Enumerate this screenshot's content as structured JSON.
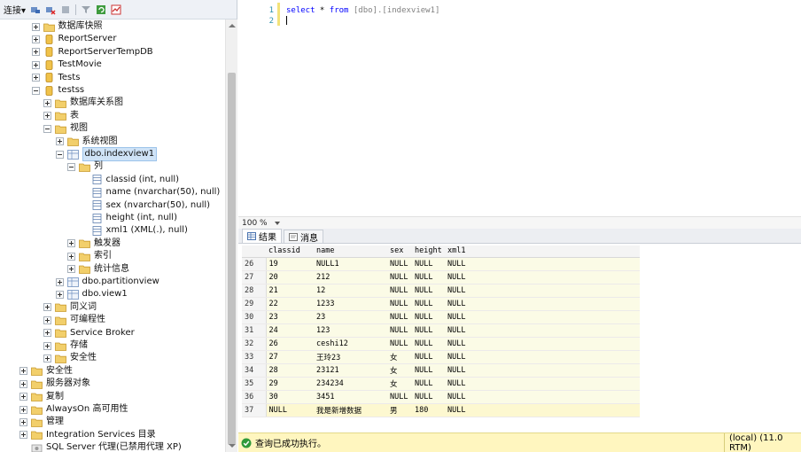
{
  "explorer": {
    "toolbar_label": "连接",
    "toolbar_dropdown": "▾",
    "tree": [
      {
        "label": "数据库快照",
        "depth": 1,
        "exp": "plus",
        "icon": "folder-icon"
      },
      {
        "label": "ReportServer",
        "depth": 1,
        "exp": "plus",
        "icon": "database-icon"
      },
      {
        "label": "ReportServerTempDB",
        "depth": 1,
        "exp": "plus",
        "icon": "database-icon"
      },
      {
        "label": "TestMovie",
        "depth": 1,
        "exp": "plus",
        "icon": "database-icon"
      },
      {
        "label": "Tests",
        "depth": 1,
        "exp": "plus",
        "icon": "database-icon"
      },
      {
        "label": "testss",
        "depth": 1,
        "exp": "minus",
        "icon": "database-icon"
      },
      {
        "label": "数据库关系图",
        "depth": 2,
        "exp": "plus",
        "icon": "folder-icon"
      },
      {
        "label": "表",
        "depth": 2,
        "exp": "plus",
        "icon": "folder-icon"
      },
      {
        "label": "视图",
        "depth": 2,
        "exp": "minus",
        "icon": "folder-icon"
      },
      {
        "label": "系统视图",
        "depth": 3,
        "exp": "plus",
        "icon": "folder-icon"
      },
      {
        "label": "dbo.indexview1",
        "depth": 3,
        "exp": "minus",
        "icon": "view-icon",
        "selected": true
      },
      {
        "label": "列",
        "depth": 4,
        "exp": "minus",
        "icon": "folder-icon"
      },
      {
        "label": "classid (int, null)",
        "depth": 5,
        "exp": "none",
        "icon": "column-icon"
      },
      {
        "label": "name (nvarchar(50), null)",
        "depth": 5,
        "exp": "none",
        "icon": "column-icon"
      },
      {
        "label": "sex (nvarchar(50), null)",
        "depth": 5,
        "exp": "none",
        "icon": "column-icon"
      },
      {
        "label": "height (int, null)",
        "depth": 5,
        "exp": "none",
        "icon": "column-icon"
      },
      {
        "label": "xml1 (XML(.), null)",
        "depth": 5,
        "exp": "none",
        "icon": "column-icon"
      },
      {
        "label": "触发器",
        "depth": 4,
        "exp": "plus",
        "icon": "folder-icon"
      },
      {
        "label": "索引",
        "depth": 4,
        "exp": "plus",
        "icon": "folder-icon"
      },
      {
        "label": "统计信息",
        "depth": 4,
        "exp": "plus",
        "icon": "folder-icon"
      },
      {
        "label": "dbo.partitionview",
        "depth": 3,
        "exp": "plus",
        "icon": "view-icon"
      },
      {
        "label": "dbo.view1",
        "depth": 3,
        "exp": "plus",
        "icon": "view-icon"
      },
      {
        "label": "同义词",
        "depth": 2,
        "exp": "plus",
        "icon": "folder-icon"
      },
      {
        "label": "可编程性",
        "depth": 2,
        "exp": "plus",
        "icon": "folder-icon"
      },
      {
        "label": "Service Broker",
        "depth": 2,
        "exp": "plus",
        "icon": "folder-icon"
      },
      {
        "label": "存储",
        "depth": 2,
        "exp": "plus",
        "icon": "folder-icon"
      },
      {
        "label": "安全性",
        "depth": 2,
        "exp": "plus",
        "icon": "folder-icon"
      },
      {
        "label": "安全性",
        "depth": 0,
        "exp": "plus",
        "icon": "folder-icon"
      },
      {
        "label": "服务器对象",
        "depth": 0,
        "exp": "plus",
        "icon": "folder-icon"
      },
      {
        "label": "复制",
        "depth": 0,
        "exp": "plus",
        "icon": "folder-icon"
      },
      {
        "label": "AlwaysOn 高可用性",
        "depth": 0,
        "exp": "plus",
        "icon": "folder-icon"
      },
      {
        "label": "管理",
        "depth": 0,
        "exp": "plus",
        "icon": "folder-icon"
      },
      {
        "label": "Integration Services 目录",
        "depth": 0,
        "exp": "plus",
        "icon": "folder-icon"
      },
      {
        "label": "SQL Server 代理(已禁用代理 XP)",
        "depth": 0,
        "exp": "none",
        "icon": "agent-icon"
      }
    ]
  },
  "editor": {
    "lines": [
      {
        "num": "1",
        "kw": "select",
        "mid": " * ",
        "kw2": "from",
        "rest": " [dbo].[indexview1]"
      },
      {
        "num": "2",
        "kw": "",
        "mid": "",
        "kw2": "",
        "rest": ""
      }
    ]
  },
  "zoom": {
    "value": "100 %"
  },
  "tabs": {
    "results": "结果",
    "messages": "消息"
  },
  "results": {
    "columns": [
      "classid",
      "name",
      "sex",
      "height",
      "xml1"
    ],
    "rows": [
      {
        "n": "26",
        "cells": [
          "19",
          "NULL1",
          "NULL",
          "NULL",
          "NULL"
        ]
      },
      {
        "n": "27",
        "cells": [
          "20",
          "212",
          "NULL",
          "NULL",
          "NULL"
        ]
      },
      {
        "n": "28",
        "cells": [
          "21",
          "12",
          "NULL",
          "NULL",
          "NULL"
        ]
      },
      {
        "n": "29",
        "cells": [
          "22",
          "1233",
          "NULL",
          "NULL",
          "NULL"
        ]
      },
      {
        "n": "30",
        "cells": [
          "23",
          "23",
          "NULL",
          "NULL",
          "NULL"
        ]
      },
      {
        "n": "31",
        "cells": [
          "24",
          "123",
          "NULL",
          "NULL",
          "NULL"
        ]
      },
      {
        "n": "32",
        "cells": [
          "26",
          "ceshi12",
          "NULL",
          "NULL",
          "NULL"
        ]
      },
      {
        "n": "33",
        "cells": [
          "27",
          "王玲23",
          "女",
          "NULL",
          "NULL"
        ]
      },
      {
        "n": "34",
        "cells": [
          "28",
          "23121",
          "女",
          "NULL",
          "NULL"
        ]
      },
      {
        "n": "35",
        "cells": [
          "29",
          "234234",
          "女",
          "NULL",
          "NULL"
        ]
      },
      {
        "n": "36",
        "cells": [
          "30",
          "3451",
          "NULL",
          "NULL",
          "NULL"
        ]
      },
      {
        "n": "37",
        "cells": [
          "NULL",
          "我是新增数据",
          "男",
          "180",
          "NULL"
        ]
      }
    ]
  },
  "status": {
    "message": "查询已成功执行。",
    "server": "(local) (11.0 RTM)"
  },
  "colors": {
    "status_bg": "#fff6bf",
    "keyword": "#0000ff",
    "line_number": "#2b91af",
    "selection": "#cfe3f7"
  }
}
